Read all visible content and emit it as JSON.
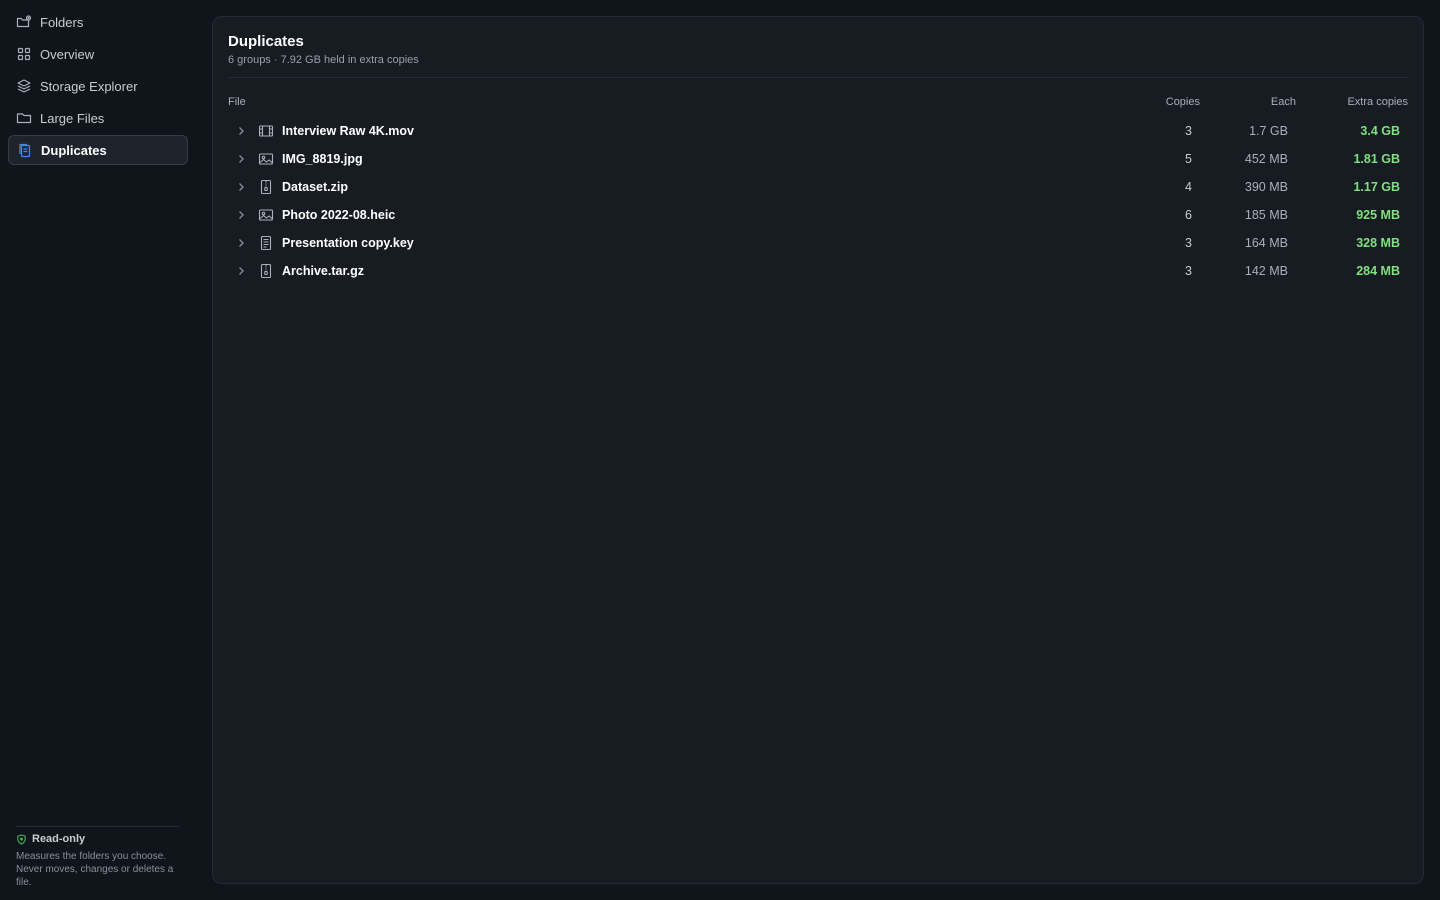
{
  "sidebar": {
    "items": [
      {
        "label": "Folders",
        "icon": "folder-plus-icon"
      },
      {
        "label": "Overview",
        "icon": "grid-icon"
      },
      {
        "label": "Storage Explorer",
        "icon": "layers-icon"
      },
      {
        "label": "Large Files",
        "icon": "folder-icon"
      },
      {
        "label": "Duplicates",
        "icon": "copy-files-icon",
        "active": true
      }
    ],
    "footer": {
      "title": "Read-only",
      "description": "Measures the folders you choose. Never moves, changes or deletes a file."
    }
  },
  "main": {
    "title": "Duplicates",
    "subtitle": "6 groups · 7.92 GB held in extra copies",
    "columns": {
      "file": "File",
      "copies": "Copies",
      "each": "Each",
      "extra": "Extra copies"
    },
    "rows": [
      {
        "name": "Interview Raw 4K.mov",
        "icon": "film-icon",
        "copies": "3",
        "each": "1.7 GB",
        "extra": "3.4 GB"
      },
      {
        "name": "IMG_8819.jpg",
        "icon": "image-icon",
        "copies": "5",
        "each": "452 MB",
        "extra": "1.81 GB"
      },
      {
        "name": "Dataset.zip",
        "icon": "archive-icon",
        "copies": "4",
        "each": "390 MB",
        "extra": "1.17 GB"
      },
      {
        "name": "Photo 2022-08.heic",
        "icon": "image-icon",
        "copies": "6",
        "each": "185 MB",
        "extra": "925 MB"
      },
      {
        "name": "Presentation copy.key",
        "icon": "document-icon",
        "copies": "3",
        "each": "164 MB",
        "extra": "328 MB"
      },
      {
        "name": "Archive.tar.gz",
        "icon": "archive-icon",
        "copies": "3",
        "each": "142 MB",
        "extra": "284 MB"
      }
    ]
  },
  "colors": {
    "accent": "#3b8eea",
    "positive": "#7ee07e",
    "shield": "#3fb950"
  }
}
